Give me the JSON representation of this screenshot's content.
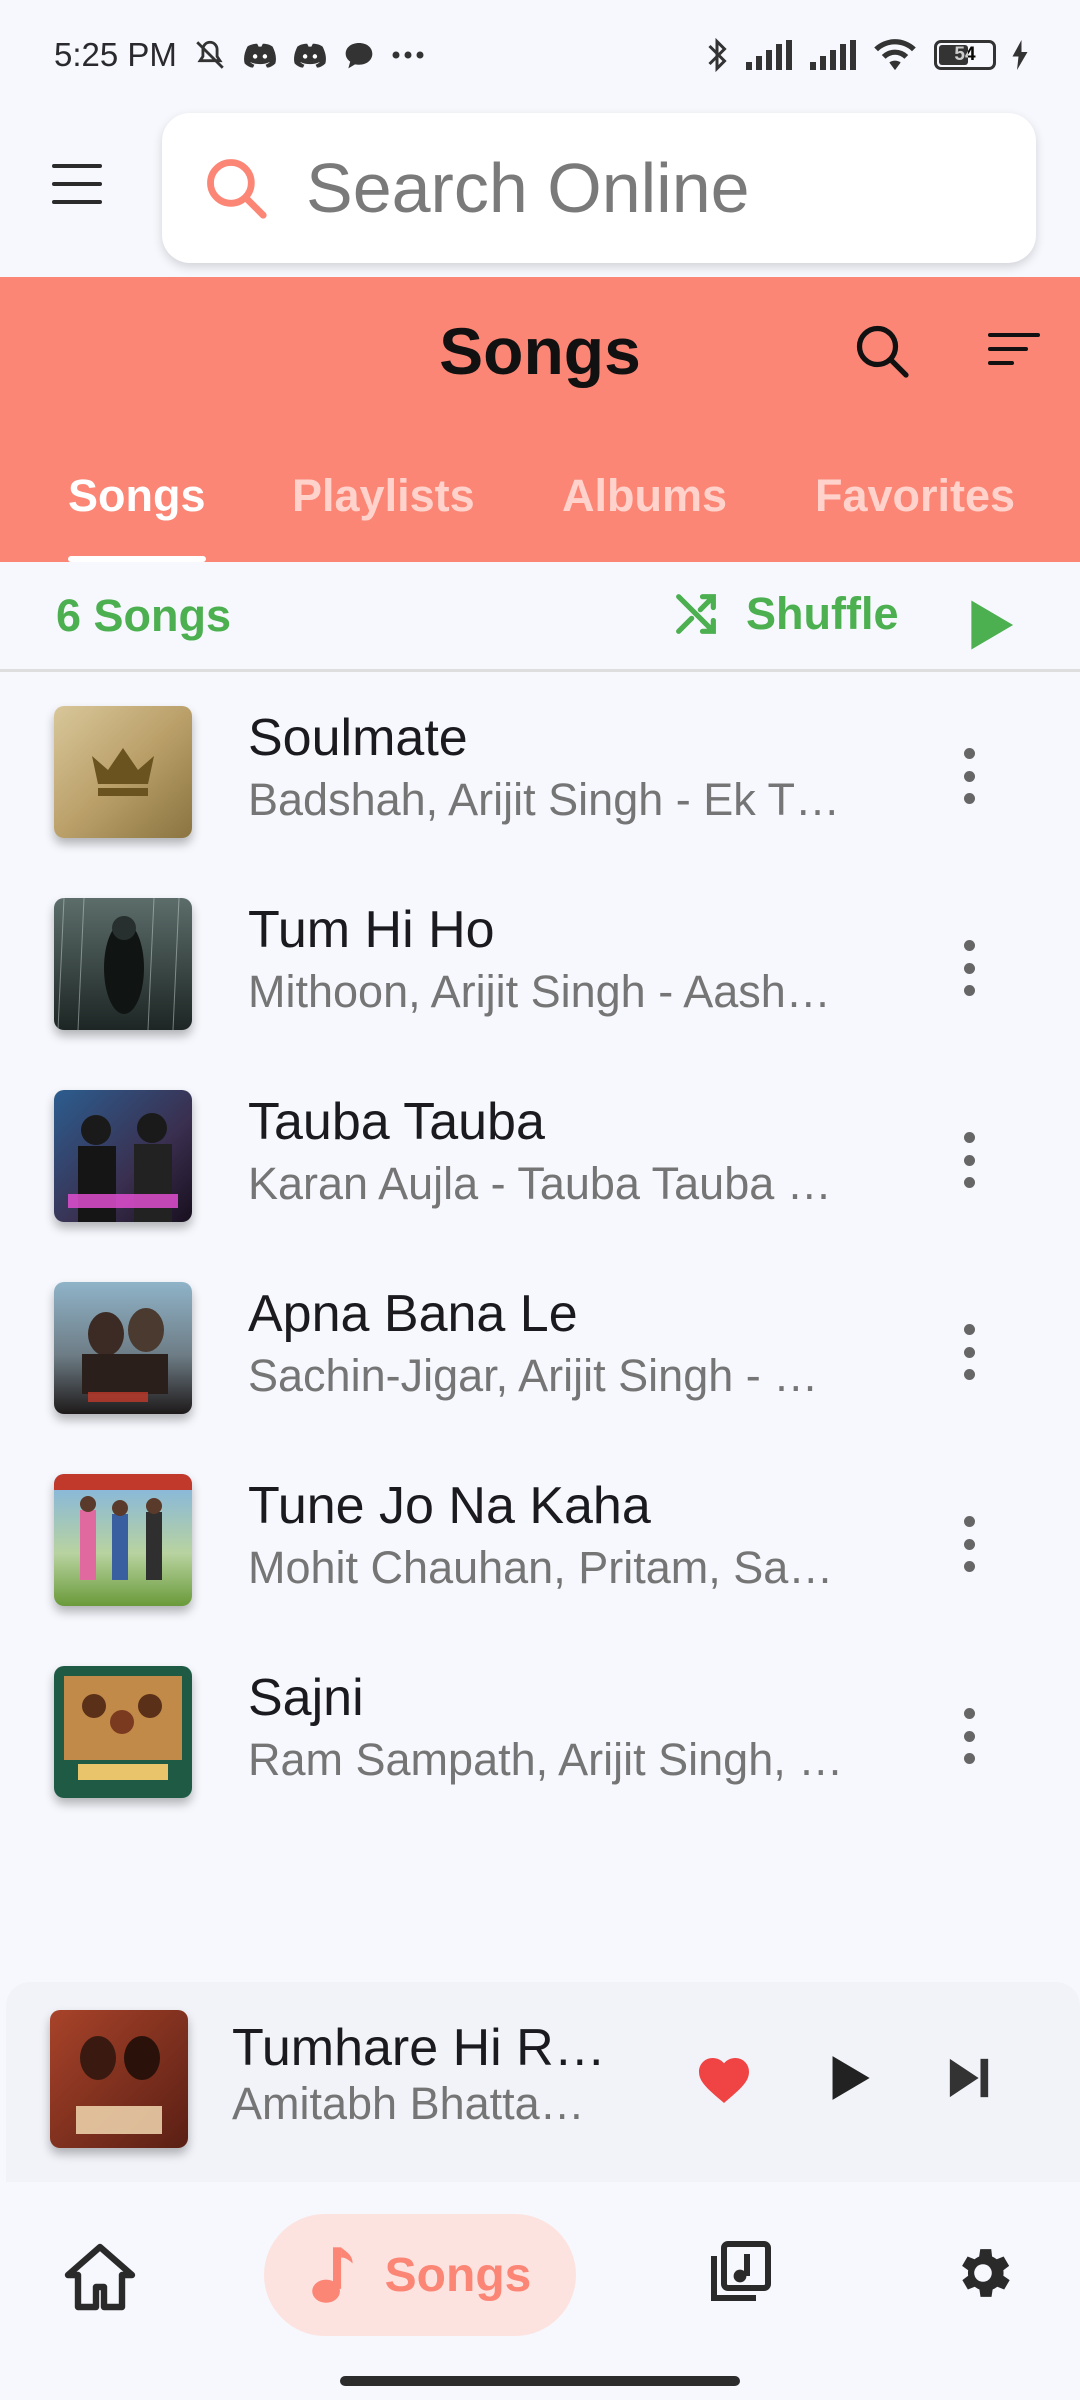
{
  "status_bar": {
    "time": "5:25 PM",
    "icons_left": [
      "mute-icon",
      "discord-icon",
      "discord-icon",
      "chat-icon",
      "more-dots-icon"
    ],
    "icons_right": [
      "bluetooth-icon",
      "signal-icon",
      "signal-icon",
      "wifi-icon",
      "battery-icon",
      "charging-icon"
    ],
    "battery": "54"
  },
  "search": {
    "placeholder": "Search Online"
  },
  "header": {
    "title": "Songs",
    "accent": "#fb8676"
  },
  "tabs": [
    {
      "label": "Songs",
      "active": true
    },
    {
      "label": "Playlists",
      "active": false
    },
    {
      "label": "Albums",
      "active": false
    },
    {
      "label": "Favorites",
      "active": false
    }
  ],
  "list_bar": {
    "count": "6 Songs",
    "shuffle_label": "Shuffle",
    "accent": "#4caf50"
  },
  "songs": [
    {
      "title": "Soulmate",
      "subtitle": "Badshah, Arijit Singh - Ek T…"
    },
    {
      "title": "Tum Hi Ho",
      "subtitle": "Mithoon, Arijit Singh - Aash…"
    },
    {
      "title": "Tauba Tauba",
      "subtitle": "Karan Aujla - Tauba Tauba …"
    },
    {
      "title": "Apna Bana Le",
      "subtitle": "Sachin-Jigar, Arijit Singh - …"
    },
    {
      "title": "Tune Jo Na Kaha",
      "subtitle": "Mohit Chauhan, Pritam, Sa…"
    },
    {
      "title": "Sajni",
      "subtitle": "Ram Sampath, Arijit Singh, …"
    }
  ],
  "now_playing": {
    "title": "Tumhare Hi R…",
    "artist": "Amitabh Bhatta…",
    "liked": true
  },
  "bottom_nav": {
    "items": [
      "home-icon",
      "songs",
      "albums-icon",
      "settings-icon"
    ],
    "active_label": "Songs"
  }
}
